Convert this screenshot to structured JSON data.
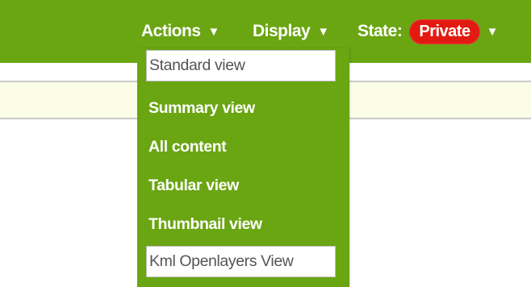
{
  "toolbar": {
    "actions_label": "Actions",
    "display_label": "Display",
    "state_label": "State:",
    "state_value": "Private",
    "arrow_glyph": "▼",
    "background_color": "#6aa512",
    "state_badge_color": "#e21b12"
  },
  "display_menu": {
    "items": [
      {
        "label": "Standard view",
        "style": "highlighted"
      },
      {
        "label": "Summary view",
        "style": "normal"
      },
      {
        "label": "All content",
        "style": "normal"
      },
      {
        "label": "Tabular view",
        "style": "normal"
      },
      {
        "label": "Thumbnail view",
        "style": "normal"
      },
      {
        "label": "Kml Openlayers View",
        "style": "highlighted"
      }
    ]
  },
  "info_strip_color": "#fbfde6"
}
